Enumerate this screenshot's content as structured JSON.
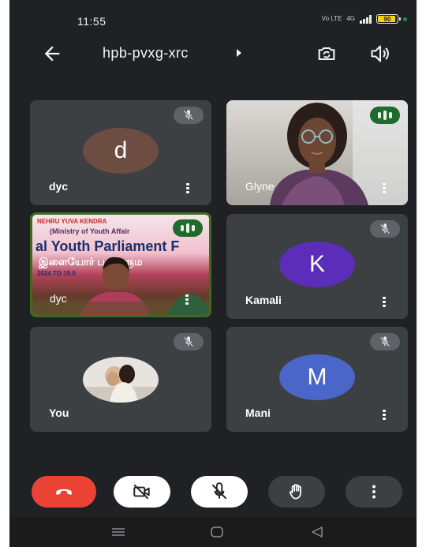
{
  "status_bar": {
    "time": "11:55",
    "network_label": "Vo LTE",
    "network_type": "4G",
    "battery": "90"
  },
  "header": {
    "meeting_code": "hpb-pvxg-xrc"
  },
  "participants": [
    {
      "name": "dyc",
      "initial": "d",
      "avatar_color": "#6d4c41",
      "muted": true
    },
    {
      "name": "Glyne",
      "muted": false,
      "speaking": true,
      "video": true
    },
    {
      "name": "dyc",
      "muted": false,
      "speaking": true,
      "video": true,
      "active": true,
      "banner": {
        "line1": "NEHRU YUVA KENDRA",
        "line2": "(Ministry of Youth Affair",
        "line3": "al Youth Parliament F",
        "line4": "இளையோர் பாராளும",
        "line5": "2024 TO 19.0"
      }
    },
    {
      "name": "Kamali",
      "initial": "K",
      "avatar_color": "#5b2db8",
      "muted": true
    },
    {
      "name": "You",
      "muted": true,
      "photo_avatar": true
    },
    {
      "name": "Mani",
      "initial": "M",
      "avatar_color": "#4a66c9",
      "muted": true
    }
  ],
  "colors": {
    "background": "#202124",
    "tile": "#3c4043",
    "end_call": "#ea4335",
    "speaking": "#1e6b2c"
  }
}
